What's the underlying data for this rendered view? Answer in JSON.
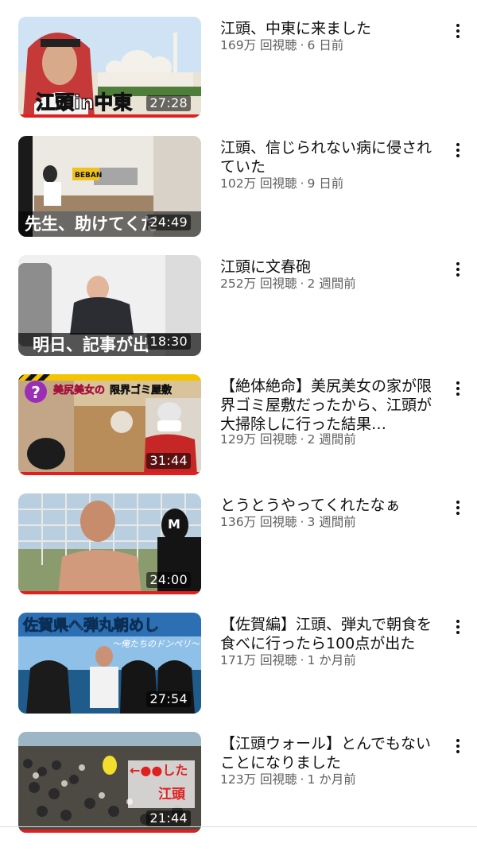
{
  "videos": [
    {
      "title": "江頭、中東に来ました",
      "views": "169万 回視聴",
      "age": "6 日前",
      "duration": "27:28",
      "caption": "江頭in中東"
    },
    {
      "title": "江頭、信じられない病に侵されていた",
      "views": "102万 回視聴",
      "age": "9 日前",
      "duration": "24:49",
      "caption": "先生、助けてくだ",
      "sign": "BEBAN"
    },
    {
      "title": "江頭に文春砲",
      "views": "252万 回視聴",
      "age": "2 週間前",
      "duration": "18:30",
      "caption": "明日、記事が出"
    },
    {
      "title": "【絶体絶命】美尻美女の家が限界ゴミ屋敷だったから、江頭が大掃除しに行った結果…",
      "views": "129万 回視聴",
      "age": "2 週間前",
      "duration": "31:44",
      "caption": "美尻美女の",
      "caption2": "限界ゴミ屋敷",
      "badge": "?"
    },
    {
      "title": "とうとうやってくれたなぁ",
      "views": "136万 回視聴",
      "age": "3 週間前",
      "duration": "24:00"
    },
    {
      "title": "【佐賀編】江頭、弾丸で朝食を食べに行ったら100点が出た",
      "views": "171万 回視聴",
      "age": "1 か月前",
      "duration": "27:54",
      "caption": "佐賀県へ弾丸朝めし",
      "caption2": "〜俺たちのドンペリ〜"
    },
    {
      "title": "【江頭ウォール】とんでもないことになりました",
      "views": "123万 回視聴",
      "age": "1 か月前",
      "duration": "21:44",
      "caption": "←●●した",
      "caption2": "江頭"
    }
  ],
  "meta_separator": "·",
  "colors": {
    "progress": "#e11f1f",
    "meta_text": "#606060",
    "title_text": "#0f0f0f"
  },
  "icons": {
    "menu": "kebab-vertical-icon"
  }
}
